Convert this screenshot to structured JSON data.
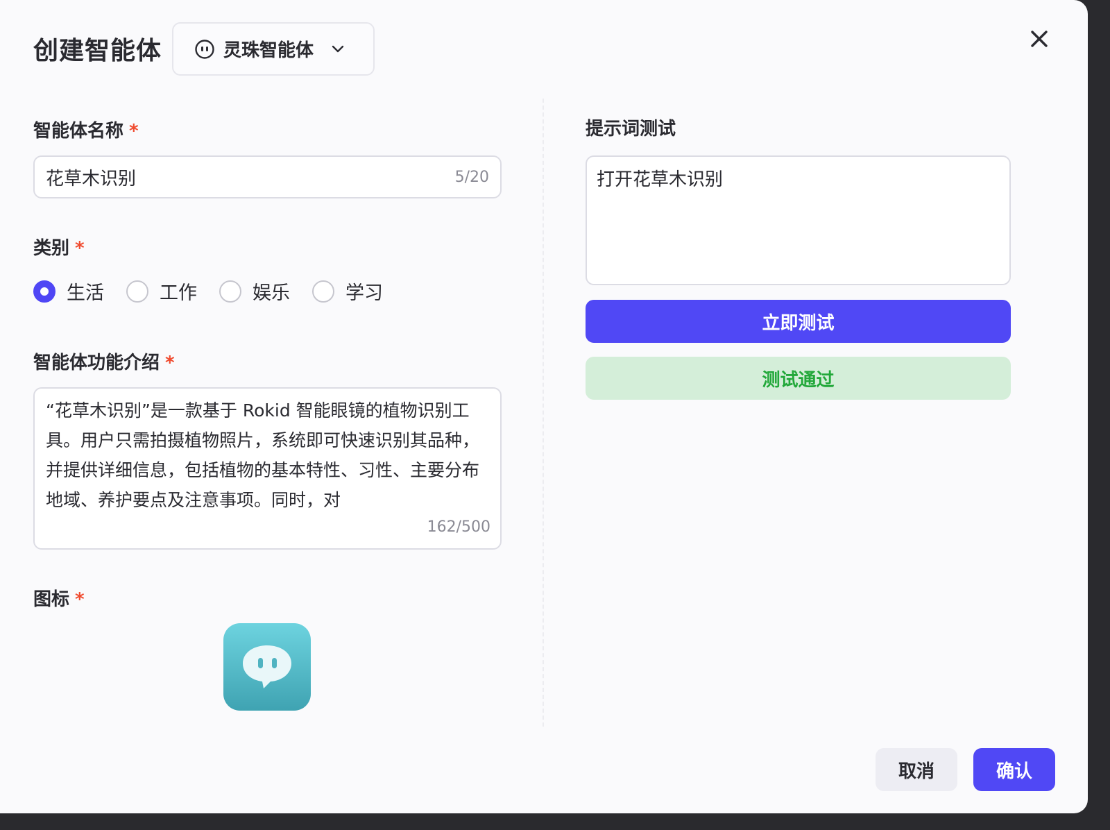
{
  "dialog": {
    "title": "创建智能体",
    "agent_selector": {
      "label": "灵珠智能体",
      "icon": "bot-face-icon"
    },
    "close_icon": "close-icon"
  },
  "form": {
    "name": {
      "label": "智能体名称",
      "required": "*",
      "value": "花草木识别",
      "count": "5/20"
    },
    "category": {
      "label": "类别",
      "required": "*",
      "options": [
        "生活",
        "工作",
        "娱乐",
        "学习"
      ],
      "selected": "生活"
    },
    "description": {
      "label": "智能体功能介绍",
      "required": "*",
      "value": "“花草木识别”是一款基于 Rokid 智能眼镜的植物识别工具。用户只需拍摄植物照片，系统即可快速识别其品种，并提供详细信息，包括植物的基本特性、习性、主要分布地域、养护要点及注意事项。同时，对",
      "count": "162/500"
    },
    "icon": {
      "label": "图标",
      "required": "*",
      "icon": "chat-bubble-icon"
    }
  },
  "prompt_test": {
    "label": "提示词测试",
    "input_value": "打开花草木识别",
    "test_button": "立即测试",
    "status": "测试通过",
    "accent": "#5048f5",
    "success_color": "#22a83a"
  },
  "footer": {
    "cancel": "取消",
    "confirm": "确认"
  }
}
